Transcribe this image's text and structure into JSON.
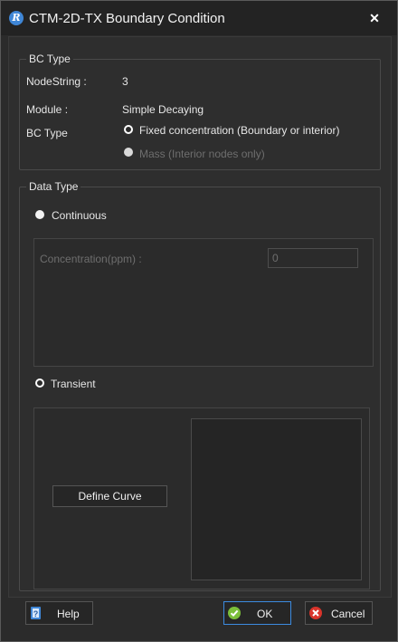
{
  "window": {
    "title": "CTM-2D-TX Boundary Condition",
    "app_icon_glyph": "R",
    "close_glyph": "✕"
  },
  "bc_type_group": {
    "legend": "BC Type",
    "nodestring_label": "NodeString :",
    "nodestring_value": "3",
    "module_label": "Module :",
    "module_value": "Simple Decaying",
    "bc_type_label": "BC Type",
    "options": [
      {
        "label": "Fixed concentration (Boundary or interior)",
        "selected": true,
        "enabled": true
      },
      {
        "label": "Mass (Interior nodes only)",
        "selected": false,
        "enabled": false
      }
    ]
  },
  "data_type_group": {
    "legend": "Data Type",
    "continuous_label": "Continuous",
    "continuous_selected": false,
    "concentration_label": "Concentration(ppm) :",
    "concentration_value": "0",
    "transient_label": "Transient",
    "transient_selected": true,
    "define_curve_label": "Define Curve"
  },
  "footer": {
    "help_label": "Help",
    "ok_label": "OK",
    "cancel_label": "Cancel"
  },
  "colors": {
    "background": "#2b2b2b",
    "text": "#e6e6e6",
    "disabled_text": "#6e6e6e",
    "ok_focus_border": "#3c8be0",
    "help_icon": "#3f86d6",
    "ok_icon": "#7bbf3a",
    "cancel_icon": "#d9342b"
  },
  "icons": {
    "app": "app-logo-icon",
    "help": "help-book-icon",
    "ok": "check-circle-icon",
    "cancel": "x-circle-icon"
  }
}
